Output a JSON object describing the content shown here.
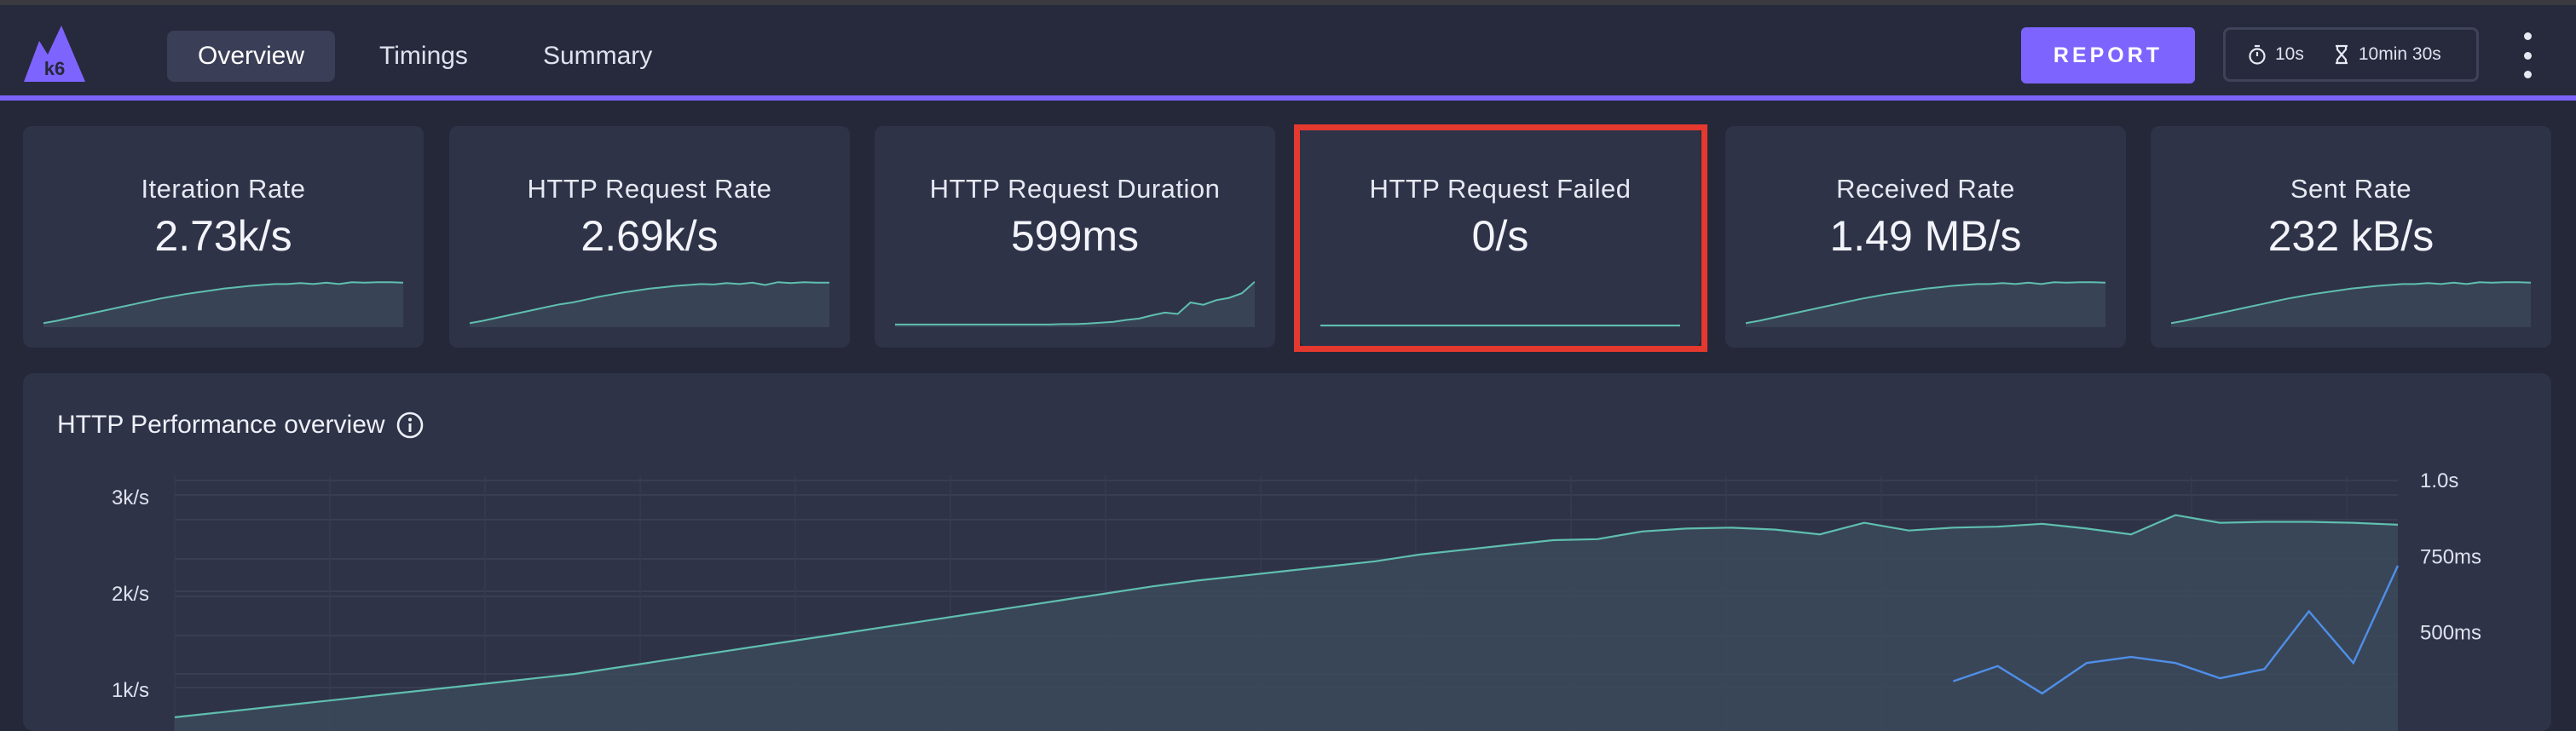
{
  "header": {
    "logo_text": "k6",
    "tabs": [
      {
        "label": "Overview",
        "active": true
      },
      {
        "label": "Timings",
        "active": false
      },
      {
        "label": "Summary",
        "active": false
      }
    ],
    "report_label": "REPORT",
    "refresh_interval": "10s",
    "duration": "10min 30s"
  },
  "colors": {
    "accent": "#7d64ff",
    "series_rate": "#5fbfae",
    "series_duration": "#4f8fe8",
    "highlight": "#e4392e"
  },
  "cards": [
    {
      "title": "Iteration Rate",
      "value": "2.73k/s",
      "trend": [
        0.05,
        0.1,
        0.16,
        0.22,
        0.28,
        0.34,
        0.4,
        0.46,
        0.52,
        0.58,
        0.63,
        0.68,
        0.72,
        0.76,
        0.8,
        0.83,
        0.86,
        0.88,
        0.9,
        0.9,
        0.92,
        0.9,
        0.93,
        0.9,
        0.94,
        0.93,
        0.94,
        0.94,
        0.93
      ]
    },
    {
      "title": "HTTP Request Rate",
      "value": "2.69k/s",
      "trend": [
        0.05,
        0.1,
        0.16,
        0.22,
        0.28,
        0.34,
        0.4,
        0.46,
        0.5,
        0.56,
        0.62,
        0.67,
        0.72,
        0.76,
        0.8,
        0.83,
        0.86,
        0.88,
        0.9,
        0.89,
        0.92,
        0.9,
        0.93,
        0.88,
        0.94,
        0.92,
        0.94,
        0.93,
        0.93
      ]
    },
    {
      "title": "HTTP Request Duration",
      "value": "599ms",
      "trend": [
        0.02,
        0.02,
        0.02,
        0.02,
        0.02,
        0.02,
        0.02,
        0.02,
        0.02,
        0.02,
        0.02,
        0.02,
        0.02,
        0.03,
        0.03,
        0.04,
        0.06,
        0.08,
        0.12,
        0.15,
        0.22,
        0.28,
        0.25,
        0.5,
        0.45,
        0.55,
        0.6,
        0.7,
        0.95
      ]
    },
    {
      "title": "HTTP Request Failed",
      "value": "0/s",
      "trend": [
        0,
        0,
        0,
        0,
        0,
        0,
        0,
        0,
        0,
        0,
        0,
        0,
        0,
        0,
        0,
        0,
        0,
        0,
        0,
        0,
        0,
        0,
        0,
        0,
        0,
        0,
        0,
        0,
        0
      ]
    },
    {
      "title": "Received Rate",
      "value": "1.49 MB/s",
      "trend": [
        0.05,
        0.1,
        0.16,
        0.22,
        0.28,
        0.34,
        0.4,
        0.46,
        0.52,
        0.58,
        0.63,
        0.68,
        0.72,
        0.76,
        0.8,
        0.83,
        0.86,
        0.88,
        0.9,
        0.9,
        0.92,
        0.9,
        0.93,
        0.9,
        0.94,
        0.93,
        0.94,
        0.94,
        0.93
      ]
    },
    {
      "title": "Sent Rate",
      "value": "232 kB/s",
      "trend": [
        0.05,
        0.1,
        0.16,
        0.22,
        0.28,
        0.34,
        0.4,
        0.46,
        0.52,
        0.58,
        0.63,
        0.68,
        0.72,
        0.76,
        0.8,
        0.83,
        0.86,
        0.88,
        0.9,
        0.9,
        0.92,
        0.9,
        0.93,
        0.9,
        0.94,
        0.93,
        0.94,
        0.94,
        0.93
      ]
    }
  ],
  "panel": {
    "title": "HTTP Performance overview"
  },
  "chart_data": {
    "type": "line",
    "title": "HTTP Performance overview",
    "y_left_ticks": [
      "3k/s",
      "2k/s",
      "1k/s"
    ],
    "y_right_ticks": [
      "1.0s",
      "750ms",
      "500ms"
    ],
    "ylim_left": [
      0,
      3000
    ],
    "ylim_right": [
      0,
      1000
    ],
    "grid": true,
    "series": [
      {
        "axis": "left",
        "style": "area",
        "values": [
          700,
          750,
          800,
          850,
          900,
          950,
          1000,
          1050,
          1100,
          1150,
          1220,
          1290,
          1360,
          1430,
          1500,
          1570,
          1640,
          1710,
          1780,
          1850,
          1920,
          1990,
          2060,
          2120,
          2170,
          2220,
          2270,
          2320,
          2390,
          2440,
          2490,
          2540,
          2550,
          2630,
          2660,
          2670,
          2650,
          2600,
          2720,
          2640,
          2670,
          2680,
          2710,
          2660,
          2600,
          2800,
          2720,
          2730,
          2730,
          2720,
          2700
        ]
      },
      {
        "axis": "right",
        "values": [
          null,
          null,
          null,
          null,
          null,
          null,
          null,
          null,
          null,
          null,
          null,
          null,
          null,
          null,
          null,
          null,
          null,
          null,
          null,
          null,
          null,
          null,
          null,
          null,
          null,
          null,
          null,
          null,
          null,
          null,
          null,
          null,
          null,
          null,
          null,
          null,
          null,
          null,
          null,
          null,
          340,
          390,
          300,
          400,
          420,
          400,
          350,
          380,
          570,
          400,
          720
        ]
      }
    ]
  }
}
